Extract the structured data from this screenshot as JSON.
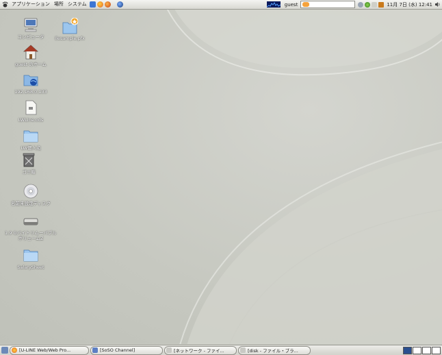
{
  "top_panel": {
    "menus": [
      "アプリケーション",
      "場所",
      "システム"
    ],
    "user": "guest",
    "clock": "11月 7日 (水) 12:41"
  },
  "desktop_icons": [
    {
      "label": "コンピュータ",
      "icon": "computer-icon"
    },
    {
      "label": "guest のホーム",
      "icon": "home-folder-icon"
    },
    {
      "label": "192.168.0.133",
      "icon": "network-share-icon"
    },
    {
      "label": "LWLine.ods",
      "icon": "document-icon"
    },
    {
      "label": "LW個人宛",
      "icon": "folder-icon"
    },
    {
      "label": "ゴミ箱",
      "icon": "trash-icon"
    },
    {
      "label": "名前未設定ディスク",
      "icon": "cd-icon"
    },
    {
      "label": "1.9 GバイトリムーバブルボリュームZ",
      "icon": "removable-drive-icon"
    },
    {
      "label": "SalarySheet",
      "icon": "folder-icon"
    },
    {
      "label": "Ilesample.pfx",
      "icon": "certificate-folder-icon"
    }
  ],
  "taskbar": {
    "tasks": [
      {
        "label": "[U-LINE Web/Web Pro...",
        "icon": "browser-icon"
      },
      {
        "label": "[SoSO Channel]",
        "icon": "chat-icon"
      },
      {
        "label": "[ネットワーク - ファイ...",
        "icon": "file-manager-icon"
      },
      {
        "label": "[disk - ファイル・ブラ...",
        "icon": "file-manager-icon"
      }
    ],
    "workspaces": 4,
    "active_workspace": 1
  }
}
